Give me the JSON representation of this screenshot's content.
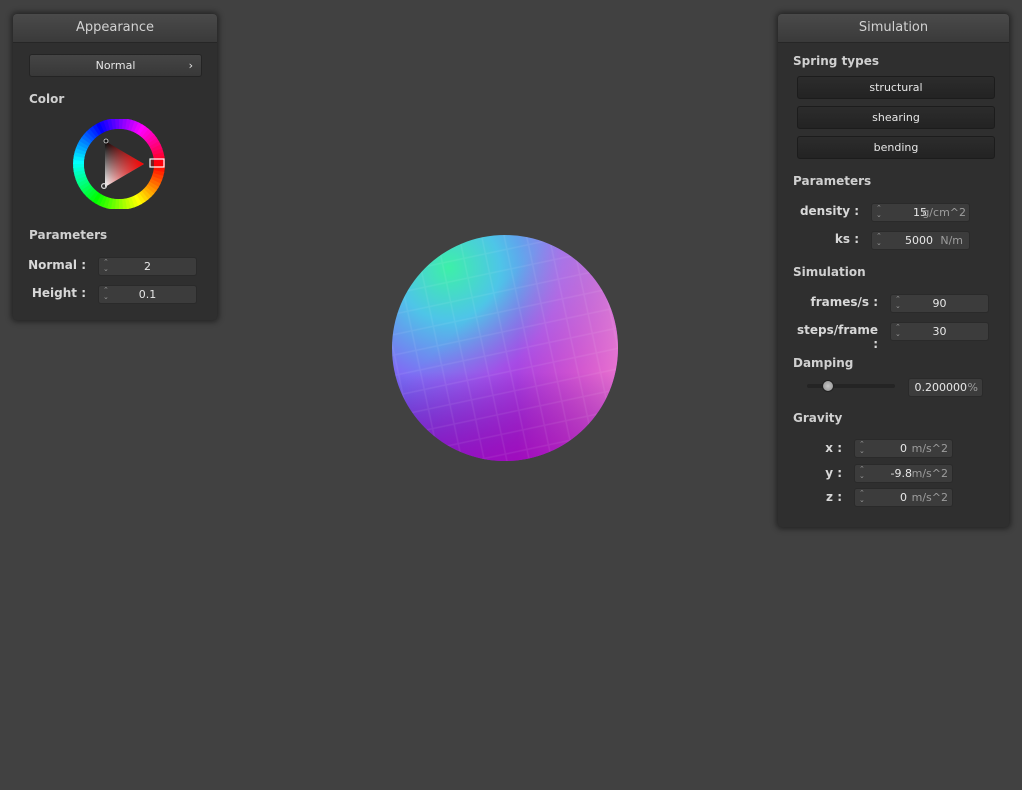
{
  "appearance": {
    "title": "Appearance",
    "shader_select": "Normal",
    "color_title": "Color",
    "selected_color": "#ff0000",
    "parameters_title": "Parameters",
    "normal_label": "Normal :",
    "normal_value": "2",
    "height_label": "Height :",
    "height_value": "0.1"
  },
  "simulation": {
    "title": "Simulation",
    "spring_types_title": "Spring types",
    "spring_types": [
      "structural",
      "shearing",
      "bending"
    ],
    "parameters_title": "Parameters",
    "density_label": "density :",
    "density_value": "15",
    "density_unit": "g/cm^2",
    "ks_label": "ks :",
    "ks_value": "5000",
    "ks_unit": "N/m",
    "simulation_title": "Simulation",
    "frames_label": "frames/s :",
    "frames_value": "90",
    "steps_label": "steps/frame :",
    "steps_value": "30",
    "damping_title": "Damping",
    "damping_fraction": 0.2,
    "damping_value": "0.200000",
    "damping_unit": "%",
    "gravity_title": "Gravity",
    "gravity": [
      {
        "label": "x :",
        "value": "0",
        "unit": "m/s^2"
      },
      {
        "label": "y :",
        "value": "-9.8",
        "unit": "m/s^2"
      },
      {
        "label": "z :",
        "value": "0",
        "unit": "m/s^2"
      }
    ]
  },
  "colors": {
    "background": "#414141",
    "panel": "#2f2f2f"
  }
}
